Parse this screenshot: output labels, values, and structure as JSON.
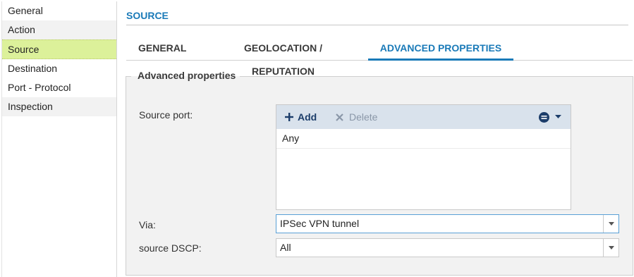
{
  "sidebar": {
    "items": [
      {
        "label": "General"
      },
      {
        "label": "Action"
      },
      {
        "label": "Source"
      },
      {
        "label": "Destination"
      },
      {
        "label": "Port - Protocol"
      },
      {
        "label": "Inspection"
      }
    ],
    "selected": "Source"
  },
  "header": {
    "title": "SOURCE"
  },
  "tabs": [
    {
      "label": "GENERAL"
    },
    {
      "label": "GEOLOCATION / REPUTATION"
    },
    {
      "label": "ADVANCED PROPERTIES"
    }
  ],
  "active_tab": "ADVANCED PROPERTIES",
  "advanced": {
    "legend": "Advanced properties",
    "source_port": {
      "label": "Source port:",
      "add_label": "Add",
      "delete_label": "Delete",
      "rows": [
        "Any"
      ]
    },
    "via": {
      "label": "Via:",
      "value": "IPSec VPN tunnel"
    },
    "dscp": {
      "label": "source DSCP:",
      "value": "All"
    }
  },
  "colors": {
    "accent": "#1a7ab8",
    "selected_sidebar": "#dcf19a",
    "toolbar_bg": "#d9e2ec",
    "panel_bg": "#f2f2f2"
  }
}
